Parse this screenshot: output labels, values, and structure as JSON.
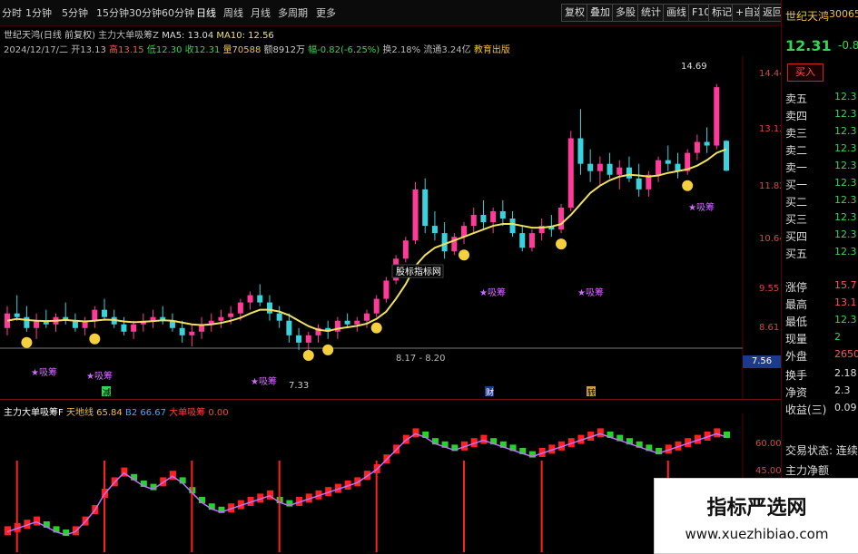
{
  "toolbar": {
    "periods": [
      "分时",
      "1分钟",
      "5分钟",
      "15分钟",
      "30分钟",
      "60分钟",
      "日线",
      "周线",
      "月线",
      "多周期",
      "更多"
    ],
    "active_period": "日线",
    "right_buttons": [
      "复权",
      "叠加",
      "多股",
      "统计",
      "画线",
      "F10",
      "标记",
      "+自选",
      "返回"
    ]
  },
  "header": {
    "stock_info": "世纪天鸿(日线 前复权)",
    "indicator_name": "主力大单吸筹Z",
    "ma5_label": "MA5: 13.04",
    "ma10_label": "MA10: 12.56",
    "date": "2024/12/17/二",
    "open": "开13.13",
    "high": "高13.15",
    "low": "低12.30",
    "close": "收12.31",
    "volume": "量70588",
    "amount": "额8912万",
    "change": "幅-0.82(-6.25%)",
    "turnover": "换2.18%",
    "circulation": "流通3.24亿",
    "sector": "教育出版"
  },
  "price_axis": [
    "14.44",
    "13.13",
    "11.82",
    "10.64",
    "9.55",
    "8.61",
    "7.56"
  ],
  "main_chart_labels": {
    "peak_label": "14.69",
    "low_label": "7.33",
    "range_label": "8.17 - 8.20",
    "mid_watermark": "股标指标网",
    "buy_marks": [
      "★吸筹",
      "★吸筹",
      "★吸筹",
      "★吸筹",
      "★吸筹",
      "★吸筹"
    ],
    "event_tags": [
      "减",
      "财",
      "转"
    ]
  },
  "indicator_header": {
    "name": "主力大单吸筹F",
    "line1": "天地线 65.84",
    "line2": "B2 66.67",
    "line3": "大单吸筹 0.00",
    "axis": [
      "60.00",
      "45.00"
    ]
  },
  "right_panel": {
    "name": "世纪天鸿",
    "code": "30065",
    "price": "12.31",
    "change": "-0.82",
    "buy_label": "买入",
    "order_book": [
      {
        "label": "卖五",
        "value": "12.3"
      },
      {
        "label": "卖四",
        "value": "12.3"
      },
      {
        "label": "卖三",
        "value": "12.3"
      },
      {
        "label": "卖二",
        "value": "12.3"
      },
      {
        "label": "卖一",
        "value": "12.3"
      },
      {
        "label": "买一",
        "value": "12.3"
      },
      {
        "label": "买二",
        "value": "12.3"
      },
      {
        "label": "买三",
        "value": "12.3"
      },
      {
        "label": "买四",
        "value": "12.3"
      },
      {
        "label": "买五",
        "value": "12.3"
      }
    ],
    "stats": [
      {
        "label": "涨停",
        "value": "15.7"
      },
      {
        "label": "最高",
        "value": "13.1"
      },
      {
        "label": "最低",
        "value": "12.3"
      },
      {
        "label": "现量",
        "value": "2"
      },
      {
        "label": "外盘",
        "value": "2650"
      },
      {
        "label": "换手",
        "value": "2.18"
      },
      {
        "label": "净资",
        "value": "2.3"
      },
      {
        "label": "收益(三)",
        "value": "0.09"
      }
    ],
    "status": "交易状态: 连续",
    "net_flow_label": "主力净额"
  },
  "watermark": {
    "title": "指标严选网",
    "url": "www.xuezhibiao.com"
  },
  "colors": {
    "up": "#ff3030",
    "down": "#39d3e0",
    "ma": "#f0e060",
    "accent": "#f0c040"
  },
  "chart_data": {
    "type": "candlestick",
    "ylim": [
      7.0,
      15.2
    ],
    "ohlc": [
      [
        8.0,
        8.6,
        7.8,
        8.4
      ],
      [
        8.4,
        8.9,
        8.2,
        8.3
      ],
      [
        8.3,
        8.6,
        7.9,
        8.0
      ],
      [
        8.0,
        8.4,
        7.7,
        8.2
      ],
      [
        8.2,
        8.5,
        8.0,
        8.1
      ],
      [
        8.1,
        8.4,
        7.9,
        8.3
      ],
      [
        8.3,
        8.7,
        8.1,
        8.2
      ],
      [
        8.2,
        8.4,
        7.9,
        8.0
      ],
      [
        8.0,
        8.3,
        7.8,
        8.2
      ],
      [
        8.2,
        8.6,
        8.0,
        8.5
      ],
      [
        8.5,
        8.8,
        8.2,
        8.3
      ],
      [
        8.3,
        8.5,
        8.0,
        8.1
      ],
      [
        8.1,
        8.3,
        7.8,
        7.9
      ],
      [
        7.9,
        8.2,
        7.7,
        8.1
      ],
      [
        8.1,
        8.4,
        7.9,
        8.2
      ],
      [
        8.2,
        8.5,
        8.0,
        8.3
      ],
      [
        8.3,
        8.6,
        8.1,
        8.2
      ],
      [
        8.2,
        8.4,
        7.9,
        8.0
      ],
      [
        8.0,
        8.2,
        7.6,
        7.8
      ],
      [
        7.8,
        8.1,
        7.5,
        7.9
      ],
      [
        7.9,
        8.3,
        7.7,
        8.1
      ],
      [
        8.1,
        8.4,
        7.9,
        8.2
      ],
      [
        8.2,
        8.5,
        8.0,
        8.3
      ],
      [
        8.3,
        8.6,
        8.1,
        8.4
      ],
      [
        8.4,
        8.8,
        8.2,
        8.7
      ],
      [
        8.7,
        9.0,
        8.5,
        8.9
      ],
      [
        8.9,
        9.2,
        8.6,
        8.7
      ],
      [
        8.7,
        8.9,
        8.2,
        8.4
      ],
      [
        8.4,
        8.6,
        8.0,
        8.2
      ],
      [
        8.2,
        8.4,
        7.6,
        7.8
      ],
      [
        7.8,
        8.0,
        7.4,
        7.6
      ],
      [
        7.6,
        7.9,
        7.33,
        7.8
      ],
      [
        7.8,
        8.1,
        7.6,
        8.0
      ],
      [
        8.0,
        8.2,
        7.7,
        7.9
      ],
      [
        7.9,
        8.3,
        7.7,
        8.2
      ],
      [
        8.2,
        8.4,
        8.0,
        8.1
      ],
      [
        8.1,
        8.3,
        7.9,
        8.2
      ],
      [
        8.2,
        8.5,
        8.0,
        8.4
      ],
      [
        8.4,
        8.9,
        8.3,
        8.8
      ],
      [
        8.8,
        9.4,
        8.7,
        9.3
      ],
      [
        9.3,
        10.0,
        9.2,
        9.9
      ],
      [
        9.9,
        10.5,
        9.8,
        10.4
      ],
      [
        10.4,
        12.0,
        10.3,
        11.8
      ],
      [
        11.8,
        12.1,
        10.6,
        10.8
      ],
      [
        10.8,
        11.2,
        10.4,
        10.6
      ],
      [
        10.6,
        10.9,
        9.9,
        10.1
      ],
      [
        10.1,
        10.6,
        10.0,
        10.5
      ],
      [
        10.5,
        10.9,
        10.3,
        10.8
      ],
      [
        10.8,
        11.3,
        10.6,
        11.1
      ],
      [
        11.1,
        11.5,
        10.7,
        10.9
      ],
      [
        10.9,
        11.3,
        10.6,
        11.2
      ],
      [
        11.2,
        11.5,
        10.8,
        11.0
      ],
      [
        11.0,
        11.2,
        10.5,
        10.6
      ],
      [
        10.6,
        10.8,
        10.1,
        10.2
      ],
      [
        10.2,
        10.7,
        10.1,
        10.6
      ],
      [
        10.6,
        11.0,
        10.4,
        10.8
      ],
      [
        10.8,
        11.1,
        10.5,
        10.7
      ],
      [
        10.7,
        11.4,
        10.6,
        11.3
      ],
      [
        11.3,
        13.4,
        11.2,
        13.2
      ],
      [
        13.2,
        14.0,
        12.2,
        12.5
      ],
      [
        12.5,
        12.9,
        12.0,
        12.3
      ],
      [
        12.3,
        12.7,
        11.9,
        12.5
      ],
      [
        12.5,
        12.8,
        12.1,
        12.2
      ],
      [
        12.2,
        12.6,
        11.8,
        12.4
      ],
      [
        12.4,
        12.7,
        12.0,
        12.1
      ],
      [
        12.1,
        12.5,
        11.6,
        11.8
      ],
      [
        11.8,
        12.3,
        11.6,
        12.2
      ],
      [
        12.2,
        12.7,
        12.0,
        12.6
      ],
      [
        12.6,
        13.0,
        12.3,
        12.5
      ],
      [
        12.5,
        12.8,
        12.1,
        12.3
      ],
      [
        12.3,
        12.9,
        12.2,
        12.8
      ],
      [
        12.8,
        13.3,
        12.6,
        13.1
      ],
      [
        13.1,
        13.5,
        12.8,
        13.0
      ],
      [
        13.0,
        14.69,
        12.9,
        14.6
      ],
      [
        13.13,
        13.15,
        12.3,
        12.31
      ]
    ],
    "ma": [
      8.2,
      8.25,
      8.22,
      8.2,
      8.19,
      8.2,
      8.22,
      8.2,
      8.18,
      8.2,
      8.23,
      8.22,
      8.18,
      8.16,
      8.17,
      8.19,
      8.21,
      8.2,
      8.15,
      8.1,
      8.08,
      8.1,
      8.14,
      8.2,
      8.28,
      8.4,
      8.5,
      8.5,
      8.45,
      8.35,
      8.2,
      8.05,
      7.95,
      7.92,
      7.98,
      8.02,
      8.06,
      8.12,
      8.25,
      8.45,
      8.8,
      9.2,
      9.7,
      10.0,
      10.2,
      10.3,
      10.4,
      10.5,
      10.6,
      10.7,
      10.8,
      10.85,
      10.85,
      10.8,
      10.75,
      10.75,
      10.78,
      10.85,
      11.1,
      11.4,
      11.7,
      11.9,
      12.05,
      12.15,
      12.2,
      12.18,
      12.15,
      12.18,
      12.25,
      12.3,
      12.35,
      12.45,
      12.6,
      12.8,
      12.9
    ],
    "indicator": [
      12,
      14,
      16,
      18,
      15,
      12,
      10,
      12,
      18,
      25,
      35,
      42,
      48,
      44,
      40,
      38,
      42,
      46,
      42,
      36,
      30,
      26,
      24,
      26,
      28,
      30,
      32,
      34,
      30,
      28,
      30,
      32,
      34,
      36,
      38,
      40,
      42,
      46,
      50,
      56,
      62,
      68,
      72,
      70,
      66,
      64,
      62,
      64,
      66,
      68,
      66,
      64,
      62,
      60,
      58,
      60,
      62,
      64,
      66,
      68,
      70,
      72,
      70,
      68,
      66,
      64,
      62,
      60,
      62,
      64,
      66,
      68,
      70,
      72,
      70
    ],
    "indicator_ylim": [
      0,
      80
    ],
    "volume_spikes": [
      1,
      10,
      19,
      28,
      38,
      47,
      55,
      68
    ]
  }
}
